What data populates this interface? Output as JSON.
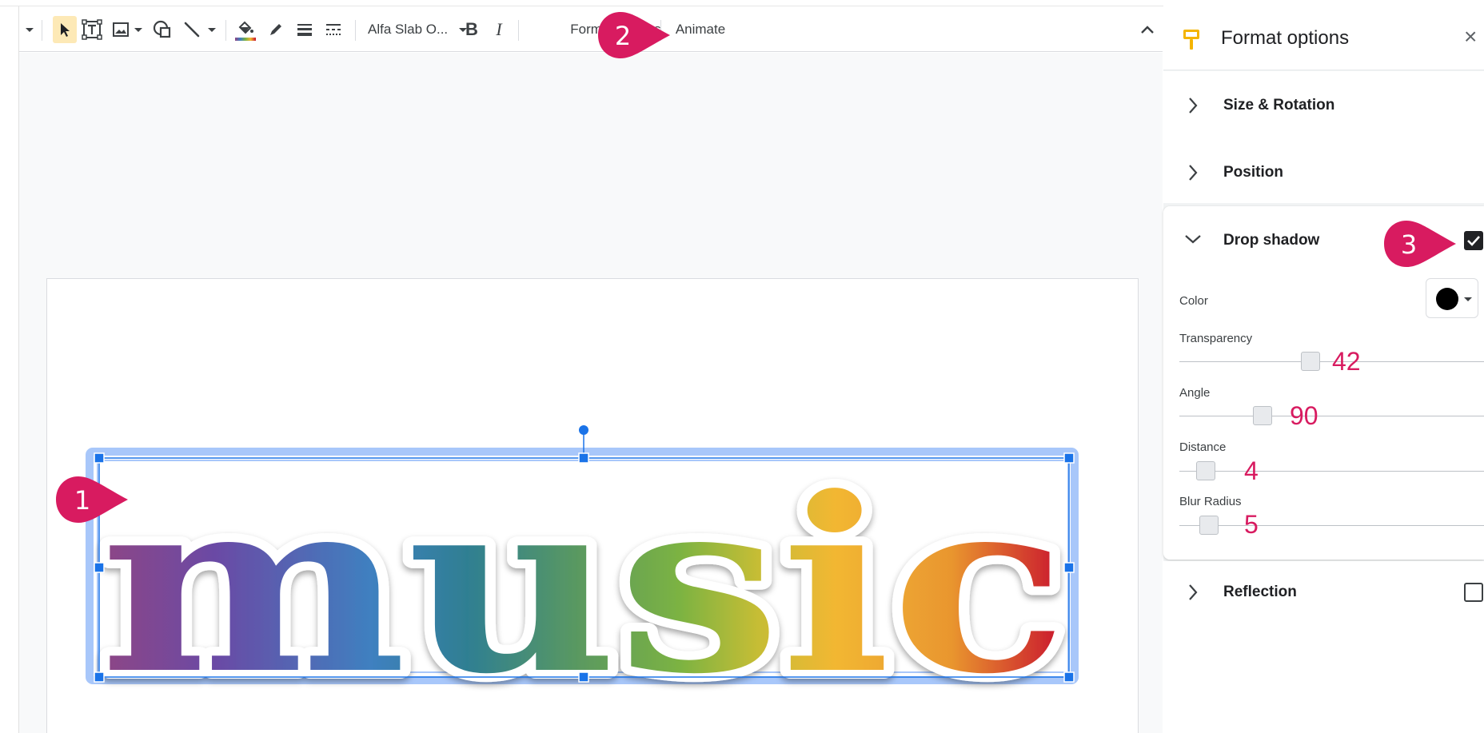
{
  "toolbar": {
    "font_name": "Alfa Slab O...",
    "bold_label": "B",
    "italic_label": "I",
    "format_options_label": "Format options",
    "animate_label": "Animate",
    "icons": [
      "menu-caret-icon",
      "select-arrow-icon",
      "text-box-icon",
      "image-icon",
      "shape-icon",
      "line-icon",
      "fill-color-icon",
      "border-color-icon",
      "border-weight-icon",
      "border-dash-icon",
      "collapse-chevron-icon"
    ]
  },
  "slide": {
    "wordart_text": "music",
    "gradient_colors": [
      "#8e4585",
      "#6a4aa5",
      "#3f80c0",
      "#2f7f92",
      "#5c9a5e",
      "#7cb342",
      "#c6bd35",
      "#f2b733",
      "#e9962f",
      "#d8441c",
      "#c8102e"
    ]
  },
  "callouts": {
    "step1": "1",
    "step2": "2",
    "step3": "3",
    "color": "#d81b60"
  },
  "panel": {
    "title": "Format options",
    "close_label": "×",
    "sections": {
      "size_rotation": "Size & Rotation",
      "position": "Position",
      "drop_shadow": "Drop shadow",
      "reflection": "Reflection"
    },
    "drop_shadow": {
      "enabled": true,
      "color_label": "Color",
      "color_value": "#000000",
      "transparency_label": "Transparency",
      "transparency_value": "42",
      "angle_label": "Angle",
      "angle_value": "90",
      "distance_label": "Distance",
      "distance_value": "4",
      "blur_label": "Blur Radius",
      "blur_value": "5"
    },
    "reflection_enabled": false,
    "accent": "#f4b400"
  }
}
